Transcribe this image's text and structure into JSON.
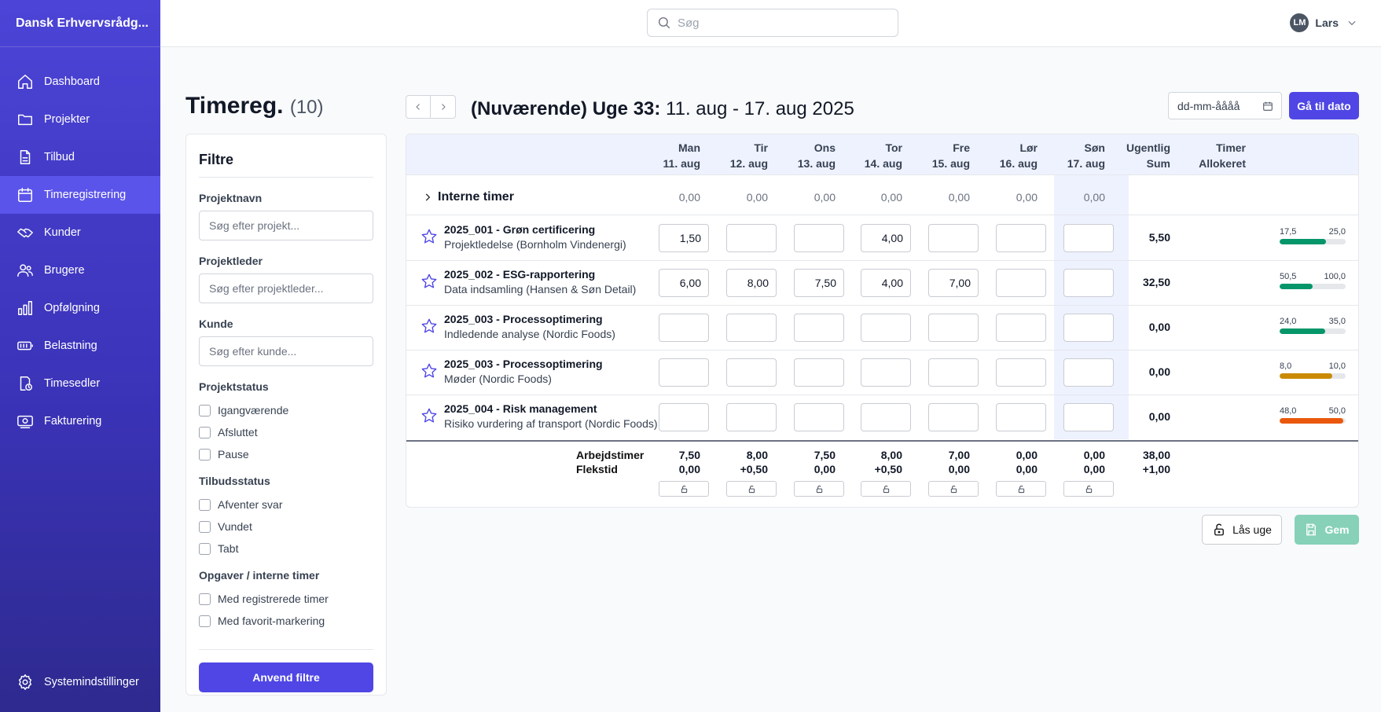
{
  "app": {
    "brand": "Dansk Erhvervsrådg..."
  },
  "sidebar": {
    "items": [
      {
        "label": "Dashboard",
        "icon": "home-icon"
      },
      {
        "label": "Projekter",
        "icon": "folder-icon"
      },
      {
        "label": "Tilbud",
        "icon": "document-icon"
      },
      {
        "label": "Timeregistrering",
        "icon": "calendar-icon",
        "active": true
      },
      {
        "label": "Kunder",
        "icon": "handshake-icon"
      },
      {
        "label": "Brugere",
        "icon": "users-icon"
      },
      {
        "label": "Opfølgning",
        "icon": "bar-chart-icon"
      },
      {
        "label": "Belastning",
        "icon": "battery-icon"
      },
      {
        "label": "Timesedler",
        "icon": "clock-file-icon"
      },
      {
        "label": "Fakturering",
        "icon": "invoice-icon"
      }
    ],
    "system_label": "Systemindstillinger"
  },
  "header": {
    "search_placeholder": "Søg",
    "user_initials": "LM",
    "user_name": "Lars"
  },
  "page": {
    "title": "Timereg.",
    "count": "(10)"
  },
  "filters": {
    "title": "Filtre",
    "project_name_label": "Projektnavn",
    "project_name_placeholder": "Søg efter projekt...",
    "project_lead_label": "Projektleder",
    "project_lead_placeholder": "Søg efter projektleder...",
    "customer_label": "Kunde",
    "customer_placeholder": "Søg efter kunde...",
    "project_status_label": "Projektstatus",
    "project_status": [
      "Igangværende",
      "Afsluttet",
      "Pause"
    ],
    "offer_status_label": "Tilbudsstatus",
    "offer_status": [
      "Afventer svar",
      "Vundet",
      "Tabt"
    ],
    "tasks_label": "Opgaver / interne timer",
    "tasks": [
      "Med registrerede timer",
      "Med favorit-markering"
    ],
    "apply_label": "Anvend filtre"
  },
  "week": {
    "title_bold": "(Nuværende) Uge 33:",
    "title_range": " 11. aug - 17. aug 2025",
    "date_placeholder": "dd-mm-åååå",
    "goto_label": "Gå til dato"
  },
  "table": {
    "columns": [
      {
        "day": "Man",
        "date": "11. aug"
      },
      {
        "day": "Tir",
        "date": "12. aug"
      },
      {
        "day": "Ons",
        "date": "13. aug"
      },
      {
        "day": "Tor",
        "date": "14. aug"
      },
      {
        "day": "Fre",
        "date": "15. aug"
      },
      {
        "day": "Lør",
        "date": "16. aug"
      },
      {
        "day": "Søn",
        "date": "17. aug"
      }
    ],
    "weekly_sum_header": [
      "Ugentlig",
      "Sum"
    ],
    "allocated_header": [
      "Timer",
      "Allokeret"
    ],
    "internal": {
      "label": "Interne timer",
      "values": [
        "0,00",
        "0,00",
        "0,00",
        "0,00",
        "0,00",
        "0,00",
        "0,00"
      ]
    },
    "rows": [
      {
        "name": "2025_001 - Grøn certificering",
        "task": "Projektledelse (Bornholm Vindenergi)",
        "hours": [
          "1,50",
          "",
          "",
          "4,00",
          "",
          "",
          ""
        ],
        "sum": "5,50",
        "used": "17,5",
        "allocated": "25,0",
        "fill": 0.7,
        "color": "#059669"
      },
      {
        "name": "2025_002 - ESG-rapportering",
        "task": "Data indsamling (Hansen & Søn Detail)",
        "hours": [
          "6,00",
          "8,00",
          "7,50",
          "4,00",
          "7,00",
          "",
          ""
        ],
        "sum": "32,50",
        "used": "50,5",
        "allocated": "100,0",
        "fill": 0.505,
        "color": "#059669"
      },
      {
        "name": "2025_003 - Processoptimering",
        "task": "Indledende analyse (Nordic Foods)",
        "hours": [
          "",
          "",
          "",
          "",
          "",
          "",
          ""
        ],
        "sum": "0,00",
        "used": "24,0",
        "allocated": "35,0",
        "fill": 0.686,
        "color": "#059669"
      },
      {
        "name": "2025_003 - Processoptimering",
        "task": "Møder (Nordic Foods)",
        "hours": [
          "",
          "",
          "",
          "",
          "",
          "",
          ""
        ],
        "sum": "0,00",
        "used": "8,0",
        "allocated": "10,0",
        "fill": 0.8,
        "color": "#ca8a04"
      },
      {
        "name": "2025_004 - Risk management",
        "task": "Risiko vurdering af transport (Nordic Foods)",
        "hours": [
          "",
          "",
          "",
          "",
          "",
          "",
          ""
        ],
        "sum": "0,00",
        "used": "48,0",
        "allocated": "50,0",
        "fill": 0.96,
        "color": "#ea580c"
      }
    ],
    "totals": {
      "work_label": "Arbejdstimer",
      "flex_label": "Flekstid",
      "work": [
        "7,50",
        "8,00",
        "7,50",
        "8,00",
        "7,00",
        "0,00",
        "0,00"
      ],
      "work_sum": "38,00",
      "flex": [
        "0,00",
        "+0,50",
        "0,00",
        "+0,50",
        "0,00",
        "0,00",
        "0,00"
      ],
      "flex_sum": "+1,00"
    }
  },
  "actions": {
    "lock_label": "Lås uge",
    "save_label": "Gem"
  }
}
